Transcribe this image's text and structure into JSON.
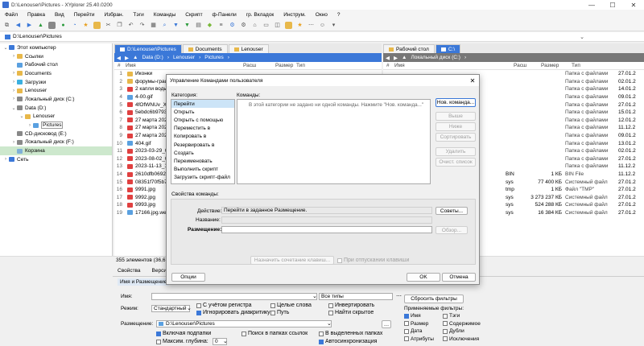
{
  "window": {
    "title": "D:\\Lenouser\\Pictures - XYplorer 25.40.0200",
    "controls": [
      "—",
      "☐",
      "✕"
    ]
  },
  "menu": [
    "Файл",
    "Правка",
    "Вид",
    "Перейти",
    "Избран.",
    "Тэги",
    "Команды",
    "Скрипт",
    "ф-Панели",
    "гр. Вкладок",
    "Инструм.",
    "Окно",
    "?"
  ],
  "address": "D:\\Lenouser\\Pictures",
  "tree": [
    {
      "label": "Этот компьютер",
      "exp": "⌄",
      "color": "#3b78d8",
      "indent": 0
    },
    {
      "label": "Ссылки",
      "exp": "›",
      "color": "#e8b84a",
      "indent": 1
    },
    {
      "label": "Рабочий стол",
      "exp": "",
      "color": "#5aa0e0",
      "indent": 1
    },
    {
      "label": "Documents",
      "exp": "›",
      "color": "#e8b84a",
      "indent": 1
    },
    {
      "label": "Загрузки",
      "exp": "›",
      "color": "#3bb0e0",
      "indent": 1
    },
    {
      "label": "Lenouser",
      "exp": "›",
      "color": "#e8b84a",
      "indent": 1
    },
    {
      "label": "Локальный диск (C:)",
      "exp": "›",
      "color": "#888",
      "indent": 1
    },
    {
      "label": "Data (D:)",
      "exp": "⌄",
      "color": "#888",
      "indent": 1
    },
    {
      "label": "Lenouser",
      "exp": "⌄",
      "color": "#e8b84a",
      "indent": 2
    },
    {
      "label": "Pictures",
      "exp": "›",
      "color": "#5aa0e0",
      "indent": 3,
      "hl": true
    },
    {
      "label": "CD-дисковод (E:)",
      "exp": "",
      "color": "#888",
      "indent": 1
    },
    {
      "label": "Локальный диск (F:)",
      "exp": "›",
      "color": "#888",
      "indent": 1
    },
    {
      "label": "Корзина",
      "exp": "",
      "color": "#7fb0d8",
      "indent": 1,
      "sel": true
    },
    {
      "label": "Сеть",
      "exp": "›",
      "color": "#3b78d8",
      "indent": 0
    }
  ],
  "left_pane": {
    "tabs": [
      {
        "label": "D:\\Lenouser\\Pictures",
        "active": true
      },
      {
        "label": "Documents",
        "active": false
      },
      {
        "label": "Lenouser",
        "active": false
      }
    ],
    "crumbs": [
      "Data (D:)",
      "Lenouser",
      "Pictures"
    ],
    "cols": {
      "num": "#",
      "name": "Имя",
      "ext": "Расш",
      "size": "Размер",
      "type": "Тип"
    },
    "rows": [
      {
        "n": "1",
        "name": "Иконки",
        "c": "#e8b84a"
      },
      {
        "n": "2",
        "name": "форумы-граф",
        "c": "#e8b84a"
      },
      {
        "n": "3",
        "name": "2 капли воды",
        "c": "#e04040"
      },
      {
        "n": "4",
        "name": "4-00.gif",
        "c": "#5aa0e0"
      },
      {
        "n": "5",
        "name": "4fOfWNUv_Xw",
        "c": "#e04040"
      },
      {
        "n": "6",
        "name": "5ebdc6b97939",
        "c": "#e04040"
      },
      {
        "n": "7",
        "name": "27 марта 2021",
        "c": "#e04040"
      },
      {
        "n": "8",
        "name": "27 марта 2021",
        "c": "#e04040"
      },
      {
        "n": "9",
        "name": "27 марта 2021",
        "c": "#e04040"
      },
      {
        "n": "10",
        "name": "404.gif",
        "c": "#5aa0e0"
      },
      {
        "n": "11",
        "name": "2023-03-29_004",
        "c": "#e04040"
      },
      {
        "n": "12",
        "name": "2023-08-02_000",
        "c": "#e04040"
      },
      {
        "n": "13",
        "name": "2023-11-13_134",
        "c": "#e04040"
      },
      {
        "n": "14",
        "name": "2610dfb06926",
        "c": "#e04040"
      },
      {
        "n": "15",
        "name": "08351f70f5b70",
        "c": "#e04040"
      },
      {
        "n": "16",
        "name": "9991.jpg",
        "c": "#e04040"
      },
      {
        "n": "17",
        "name": "9992.jpg",
        "c": "#e04040"
      },
      {
        "n": "18",
        "name": "9993.jpg",
        "c": "#e04040"
      },
      {
        "n": "19",
        "name": "17166.jpg.webp",
        "c": "#5aa0e0"
      }
    ]
  },
  "right_pane": {
    "tabs": [
      {
        "label": "Рабочий стол",
        "active": false
      },
      {
        "label": "C:\\",
        "active": true
      }
    ],
    "crumbs": [
      "Локальный диск (C:)"
    ],
    "cols": {
      "num": "#",
      "name": "Имя",
      "ext": "Расш",
      "size": "Размер",
      "type": "Тип"
    },
    "rows": [
      {
        "ext": "",
        "size": "",
        "type": "Папка с файлами",
        "date": "27.01.2"
      },
      {
        "ext": "",
        "size": "",
        "type": "Папка с файлами",
        "date": "02.01.2"
      },
      {
        "ext": "",
        "size": "",
        "type": "Папка с файлами",
        "date": "14.01.2"
      },
      {
        "ext": "",
        "size": "",
        "type": "Папка с файлами",
        "date": "09.01.2"
      },
      {
        "ext": "",
        "size": "",
        "type": "Папка с файлами",
        "date": "27.01.2"
      },
      {
        "ext": "",
        "size": "",
        "type": "Папка с файлами",
        "date": "15.01.2"
      },
      {
        "ext": "",
        "size": "",
        "type": "Папка с файлами",
        "date": "12.01.2"
      },
      {
        "ext": "",
        "size": "",
        "type": "Папка с файлами",
        "date": "11.12.2"
      },
      {
        "ext": "",
        "size": "",
        "type": "Папка с файлами",
        "date": "09.01.2"
      },
      {
        "ext": "",
        "size": "",
        "type": "Папка с файлами",
        "date": "13.01.2"
      },
      {
        "ext": "",
        "size": "",
        "type": "Папка с файлами",
        "date": "02.01.2"
      },
      {
        "ext": "",
        "size": "",
        "type": "Папка с файлами",
        "date": "27.01.2"
      },
      {
        "ext": "",
        "size": "",
        "type": "Папка с файлами",
        "date": "11.12.2"
      },
      {
        "ext": "BIN",
        "size": "1 КБ",
        "type": "BIN File",
        "date": "11.12.2"
      },
      {
        "ext": "sys",
        "size": "77 400 КБ",
        "type": "Системный файл",
        "date": "27.01.2"
      },
      {
        "ext": "tmp",
        "size": "1 КБ",
        "type": "Файл \"TMP\"",
        "date": "27.01.2"
      },
      {
        "ext": "sys",
        "size": "3 273 237 КБ",
        "type": "Системный файл",
        "date": "27.01.2"
      },
      {
        "ext": "sys",
        "size": "524 288 КБ",
        "type": "Системный файл",
        "date": "27.01.2"
      },
      {
        "ext": "sys",
        "size": "16 384 КБ",
        "type": "Системный файл",
        "date": "27.01.2"
      }
    ]
  },
  "status": "355 элементов (36,67 ГБ",
  "bottom_tabs": [
    "Свойства",
    "Верси"
  ],
  "filter": {
    "section_title": "Имя и Размещение",
    "name_label": "Имя:",
    "types_value": "Все типы",
    "mode_label": "Режим:",
    "mode_value": "Стандартный",
    "checks": [
      {
        "label": "С учётом регистра",
        "on": false
      },
      {
        "label": "Игнорировать диакритику",
        "on": true
      },
      {
        "label": "Целые слова",
        "on": false
      },
      {
        "label": "Путь",
        "on": false
      },
      {
        "label": "Инвертировать",
        "on": false
      },
      {
        "label": "Найти скрытое",
        "on": false
      }
    ],
    "reset_button": "Сбросить фильтры",
    "applied_title": "Применяемые фильтры:",
    "applied": [
      {
        "label": "Имя",
        "on": true
      },
      {
        "label": "Тэги",
        "on": false
      },
      {
        "label": "Размер",
        "on": false
      },
      {
        "label": "Содержимое",
        "on": false
      },
      {
        "label": "Дата",
        "on": false
      },
      {
        "label": "Дубли",
        "on": false
      },
      {
        "label": "Атрибуты",
        "on": false
      },
      {
        "label": "Исключения",
        "on": false
      }
    ],
    "location_label": "Размещение:",
    "location_value": "D:\\Lenouser\\Pictures",
    "include_sub": "Включая подпапки",
    "depth_label": "Максим. глубина:",
    "depth_value": "0",
    "checks2": [
      {
        "label": "Поиск в папках ссылок",
        "on": false
      },
      {
        "label": "В выделенных папках",
        "on": false
      },
      {
        "label": "Автосинхронизация",
        "on": true
      }
    ]
  },
  "dialog": {
    "title": "Управление Командами пользователя",
    "category_label": "Категория:",
    "categories": [
      "Перейти",
      "Открыть",
      "Открыть с помощью",
      "Переместить в",
      "Копировать в",
      "Резервировать в",
      "Создать",
      "Переименовать",
      "Выполнить скрипт",
      "Загрузить скрипт-файл"
    ],
    "commands_label": "Команды:",
    "empty_text": "В этой категории не задано ни одной команды. Нажмите \"Нов. команда...\"",
    "buttons": {
      "new": "Нов. команда...",
      "up": "Выше",
      "down": "Ниже",
      "sort": "Сортировать",
      "delete": "Удалить",
      "clear": "Очист. список"
    },
    "props_label": "Свойства команды:",
    "action_label": "Действие:",
    "action_value": "Перейти в заданное Размещение.",
    "tips_button": "Советы...",
    "name_label": "Название:",
    "location_label": "Размещение:",
    "browse_button": "Обзор...",
    "shortcut_button": "Назначить сочетание клавиш...",
    "default_check": "При отпускании клавиши",
    "options_button": "Опции",
    "ok_button": "OK",
    "cancel_button": "Отмена"
  }
}
